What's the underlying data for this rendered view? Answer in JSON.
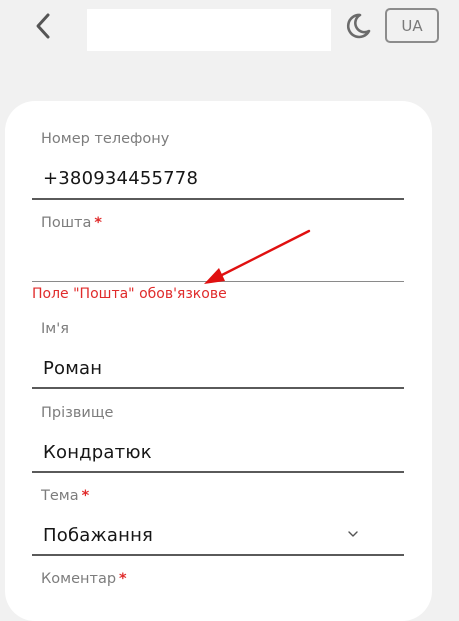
{
  "header": {
    "back_icon": "chevron-left-icon",
    "title": "",
    "theme_icon": "moon-icon",
    "lang_label": "UA"
  },
  "form": {
    "phone": {
      "label": "Номер телефону",
      "value": "+380934455778",
      "required": false
    },
    "email": {
      "label": "Пошта",
      "value": "",
      "required": true,
      "error": "Поле \"Пошта\" обов'язкове"
    },
    "name": {
      "label": "Ім'я",
      "value": "Роман",
      "required": false
    },
    "surname": {
      "label": "Прізвище",
      "value": "Кондратюк",
      "required": false
    },
    "topic": {
      "label": "Тема",
      "value": "Побажання",
      "required": true,
      "dropdown_icon": "chevron-down-icon"
    },
    "comment": {
      "label": "Коментар",
      "value": "",
      "required": true
    }
  },
  "required_mark": "*",
  "colors": {
    "background": "#f1f1f1",
    "card": "#ffffff",
    "error": "#e02b2b",
    "label": "#7d7d7d",
    "annotation_arrow": "#e01010"
  }
}
